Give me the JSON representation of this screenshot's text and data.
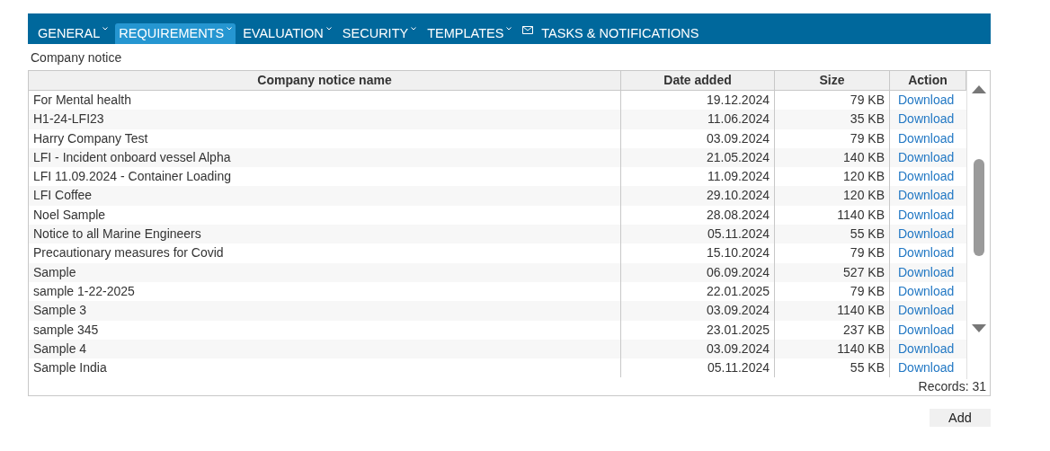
{
  "menu": [
    {
      "label": "GENERAL",
      "dropdown": true,
      "selected": false
    },
    {
      "label": "REQUIREMENTS",
      "dropdown": true,
      "selected": true
    },
    {
      "label": "EVALUATION",
      "dropdown": true,
      "selected": false
    },
    {
      "label": "SECURITY",
      "dropdown": true,
      "selected": false
    },
    {
      "label": "TEMPLATES",
      "dropdown": true,
      "selected": false
    },
    {
      "label": "TASKS & NOTIFICATIONS",
      "dropdown": false,
      "selected": false
    }
  ],
  "section_title": "Company notice",
  "table": {
    "columns": [
      "Company notice name",
      "Date added",
      "Size",
      "Action"
    ],
    "rows": [
      [
        "For Mental health",
        "19.12.2024",
        "79 KB",
        "Download"
      ],
      [
        "H1-24-LFI23",
        "11.06.2024",
        "35 KB",
        "Download"
      ],
      [
        "Harry Company Test",
        "03.09.2024",
        "79 KB",
        "Download"
      ],
      [
        "LFI - Incident onboard vessel Alpha",
        "21.05.2024",
        "140 KB",
        "Download"
      ],
      [
        "LFI 11.09.2024 - Container Loading",
        "11.09.2024",
        "120 KB",
        "Download"
      ],
      [
        "LFI Coffee",
        "29.10.2024",
        "120 KB",
        "Download"
      ],
      [
        "Noel Sample",
        "28.08.2024",
        "1140 KB",
        "Download"
      ],
      [
        "Notice to all Marine Engineers",
        "05.11.2024",
        "55 KB",
        "Download"
      ],
      [
        "Precautionary measures for Covid",
        "15.10.2024",
        "79 KB",
        "Download"
      ],
      [
        "Sample",
        "06.09.2024",
        "527 KB",
        "Download"
      ],
      [
        "sample 1-22-2025",
        "22.01.2025",
        "79 KB",
        "Download"
      ],
      [
        "Sample 3",
        "03.09.2024",
        "1140 KB",
        "Download"
      ],
      [
        "sample 345",
        "23.01.2025",
        "237 KB",
        "Download"
      ],
      [
        "Sample 4",
        "03.09.2024",
        "1140 KB",
        "Download"
      ],
      [
        "Sample India",
        "05.11.2024",
        "55 KB",
        "Download"
      ]
    ],
    "records": "Records: 31"
  },
  "add_button": "Add"
}
